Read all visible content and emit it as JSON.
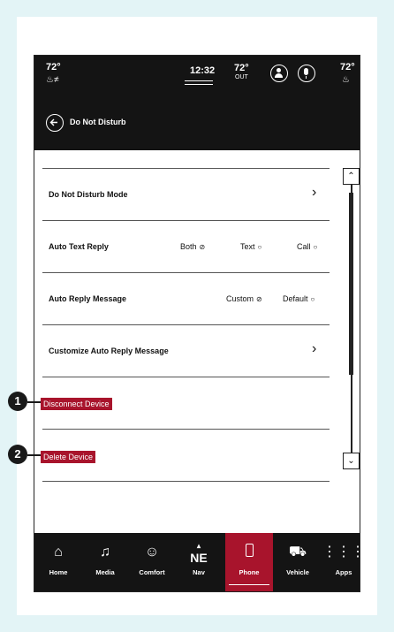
{
  "status": {
    "left_temp": "72°",
    "time": "12:32",
    "outside_temp": "72°",
    "outside_label": "OUT",
    "right_temp": "72°"
  },
  "header": {
    "title": "Do Not Disturb"
  },
  "rows": {
    "dnd_mode": "Do Not Disturb Mode",
    "auto_text_reply": "Auto Text Reply",
    "auto_text_options": {
      "both": "Both",
      "text": "Text",
      "call": "Call"
    },
    "auto_reply_message": "Auto Reply Message",
    "auto_reply_options": {
      "custom": "Custom",
      "default": "Default"
    },
    "customize": "Customize Auto Reply Message",
    "disconnect": "Disconnect Device",
    "delete": "Delete Device"
  },
  "nav": [
    {
      "label": "Home",
      "icon": "home-icon"
    },
    {
      "label": "Media",
      "icon": "music-note-icon"
    },
    {
      "label": "Comfort",
      "icon": "comfort-icon"
    },
    {
      "label": "Nav",
      "icon": "compass-ne-icon"
    },
    {
      "label": "Phone",
      "icon": "phone-icon"
    },
    {
      "label": "Vehicle",
      "icon": "car-icon"
    },
    {
      "label": "Apps",
      "icon": "apps-grid-icon"
    }
  ],
  "nav_direction": "NE",
  "callouts": {
    "one": "1",
    "two": "2"
  },
  "colors": {
    "accent": "#a8142c",
    "bar": "#141414",
    "page_bg": "#e3f4f6"
  },
  "selected": {
    "auto_text_reply": "Both",
    "auto_reply_message": "Custom",
    "nav": "Phone"
  }
}
